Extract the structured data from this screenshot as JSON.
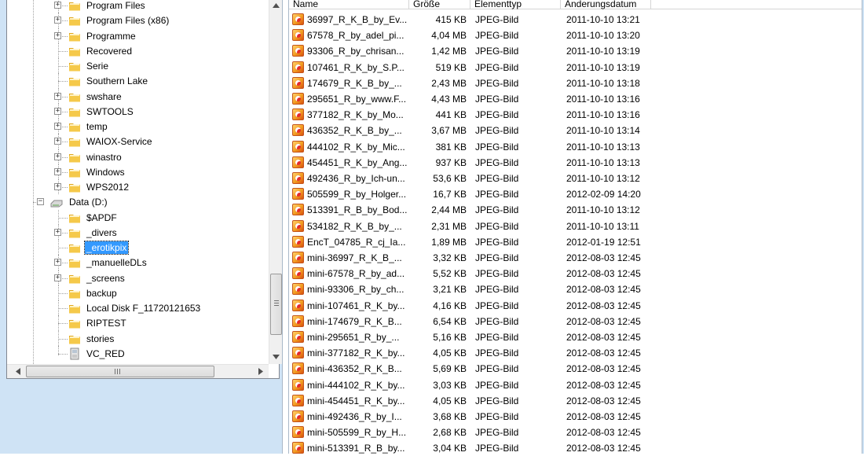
{
  "tree": {
    "items": [
      {
        "label": "Program Files",
        "level": 2,
        "expander": "+",
        "icon": "folder-icon"
      },
      {
        "label": "Program Files (x86)",
        "level": 2,
        "expander": "+",
        "icon": "folder-icon"
      },
      {
        "label": "Programme",
        "level": 2,
        "expander": "+",
        "icon": "folder-icon"
      },
      {
        "label": "Recovered",
        "level": 2,
        "expander": "",
        "icon": "folder-icon"
      },
      {
        "label": "Serie",
        "level": 2,
        "expander": "",
        "icon": "folder-icon"
      },
      {
        "label": "Southern Lake",
        "level": 2,
        "expander": "",
        "icon": "folder-icon"
      },
      {
        "label": "swshare",
        "level": 2,
        "expander": "+",
        "icon": "folder-icon"
      },
      {
        "label": "SWTOOLS",
        "level": 2,
        "expander": "+",
        "icon": "folder-icon"
      },
      {
        "label": "temp",
        "level": 2,
        "expander": "+",
        "icon": "folder-icon"
      },
      {
        "label": "WAIOX-Service",
        "level": 2,
        "expander": "+",
        "icon": "folder-icon"
      },
      {
        "label": "winastro",
        "level": 2,
        "expander": "+",
        "icon": "folder-icon"
      },
      {
        "label": "Windows",
        "level": 2,
        "expander": "+",
        "icon": "folder-icon"
      },
      {
        "label": "WPS2012",
        "level": 2,
        "expander": "+",
        "icon": "folder-icon"
      },
      {
        "label": "Data (D:)",
        "level": 1,
        "expander": "−",
        "icon": "drive-icon"
      },
      {
        "label": "$APDF",
        "level": 2,
        "expander": "",
        "icon": "folder-icon"
      },
      {
        "label": "_divers",
        "level": 2,
        "expander": "+",
        "icon": "folder-icon"
      },
      {
        "label": "_erotikpix",
        "level": 2,
        "expander": "",
        "icon": "folder-icon",
        "selected": true
      },
      {
        "label": "_manuelleDLs",
        "level": 2,
        "expander": "+",
        "icon": "folder-icon"
      },
      {
        "label": "_screens",
        "level": 2,
        "expander": "+",
        "icon": "folder-icon"
      },
      {
        "label": "backup",
        "level": 2,
        "expander": "",
        "icon": "folder-icon"
      },
      {
        "label": "Local Disk F_11720121653",
        "level": 2,
        "expander": "",
        "icon": "folder-icon"
      },
      {
        "label": "RIPTEST",
        "level": 2,
        "expander": "",
        "icon": "folder-icon"
      },
      {
        "label": "stories",
        "level": 2,
        "expander": "",
        "icon": "folder-icon"
      },
      {
        "label": "VC_RED",
        "level": 2,
        "expander": "",
        "icon": "installer-icon"
      }
    ]
  },
  "list": {
    "columns": {
      "name": "Name",
      "size": "Größe",
      "type": "Elementtyp",
      "date": "Änderungsdatum"
    },
    "rows": [
      {
        "name": "36997_R_K_B_by_Ev...",
        "size": "415 KB",
        "type": "JPEG-Bild",
        "date": "2011-10-10 13:21"
      },
      {
        "name": "67578_R_by_adel_pi...",
        "size": "4,04 MB",
        "type": "JPEG-Bild",
        "date": "2011-10-10 13:20"
      },
      {
        "name": "93306_R_by_chrisan...",
        "size": "1,42 MB",
        "type": "JPEG-Bild",
        "date": "2011-10-10 13:19"
      },
      {
        "name": "107461_R_K_by_S.P...",
        "size": "519 KB",
        "type": "JPEG-Bild",
        "date": "2011-10-10 13:19"
      },
      {
        "name": "174679_R_K_B_by_...",
        "size": "2,43 MB",
        "type": "JPEG-Bild",
        "date": "2011-10-10 13:18"
      },
      {
        "name": "295651_R_by_www.F...",
        "size": "4,43 MB",
        "type": "JPEG-Bild",
        "date": "2011-10-10 13:16"
      },
      {
        "name": "377182_R_K_by_Mo...",
        "size": "441 KB",
        "type": "JPEG-Bild",
        "date": "2011-10-10 13:16"
      },
      {
        "name": "436352_R_K_B_by_...",
        "size": "3,67 MB",
        "type": "JPEG-Bild",
        "date": "2011-10-10 13:14"
      },
      {
        "name": "444102_R_K_by_Mic...",
        "size": "381 KB",
        "type": "JPEG-Bild",
        "date": "2011-10-10 13:13"
      },
      {
        "name": "454451_R_K_by_Ang...",
        "size": "937 KB",
        "type": "JPEG-Bild",
        "date": "2011-10-10 13:13"
      },
      {
        "name": "492436_R_by_Ich-un...",
        "size": "53,6 KB",
        "type": "JPEG-Bild",
        "date": "2011-10-10 13:12"
      },
      {
        "name": "505599_R_by_Holger...",
        "size": "16,7 KB",
        "type": "JPEG-Bild",
        "date": "2012-02-09 14:20"
      },
      {
        "name": "513391_R_B_by_Bod...",
        "size": "2,44 MB",
        "type": "JPEG-Bild",
        "date": "2011-10-10 13:12"
      },
      {
        "name": "534182_R_K_B_by_...",
        "size": "2,31 MB",
        "type": "JPEG-Bild",
        "date": "2011-10-10 13:11"
      },
      {
        "name": "EncT_04785_R_cj_Ia...",
        "size": "1,89 MB",
        "type": "JPEG-Bild",
        "date": "2012-01-19 12:51"
      },
      {
        "name": "mini-36997_R_K_B_...",
        "size": "3,32 KB",
        "type": "JPEG-Bild",
        "date": "2012-08-03 12:45"
      },
      {
        "name": "mini-67578_R_by_ad...",
        "size": "5,52 KB",
        "type": "JPEG-Bild",
        "date": "2012-08-03 12:45"
      },
      {
        "name": "mini-93306_R_by_ch...",
        "size": "3,21 KB",
        "type": "JPEG-Bild",
        "date": "2012-08-03 12:45"
      },
      {
        "name": "mini-107461_R_K_by...",
        "size": "4,16 KB",
        "type": "JPEG-Bild",
        "date": "2012-08-03 12:45"
      },
      {
        "name": "mini-174679_R_K_B...",
        "size": "6,54 KB",
        "type": "JPEG-Bild",
        "date": "2012-08-03 12:45"
      },
      {
        "name": "mini-295651_R_by_...",
        "size": "5,16 KB",
        "type": "JPEG-Bild",
        "date": "2012-08-03 12:45"
      },
      {
        "name": "mini-377182_R_K_by...",
        "size": "4,05 KB",
        "type": "JPEG-Bild",
        "date": "2012-08-03 12:45"
      },
      {
        "name": "mini-436352_R_K_B...",
        "size": "5,69 KB",
        "type": "JPEG-Bild",
        "date": "2012-08-03 12:45"
      },
      {
        "name": "mini-444102_R_K_by...",
        "size": "3,03 KB",
        "type": "JPEG-Bild",
        "date": "2012-08-03 12:45"
      },
      {
        "name": "mini-454451_R_K_by...",
        "size": "4,05 KB",
        "type": "JPEG-Bild",
        "date": "2012-08-03 12:45"
      },
      {
        "name": "mini-492436_R_by_I...",
        "size": "3,68 KB",
        "type": "JPEG-Bild",
        "date": "2012-08-03 12:45"
      },
      {
        "name": "mini-505599_R_by_H...",
        "size": "2,68 KB",
        "type": "JPEG-Bild",
        "date": "2012-08-03 12:45"
      },
      {
        "name": "mini-513391_R_B_by...",
        "size": "3,04 KB",
        "type": "JPEG-Bild",
        "date": "2012-08-03 12:45"
      }
    ]
  },
  "colors": {
    "pane_bg": "#cfe3f5",
    "selection": "#3399ff",
    "folder": "#f5c94a"
  }
}
